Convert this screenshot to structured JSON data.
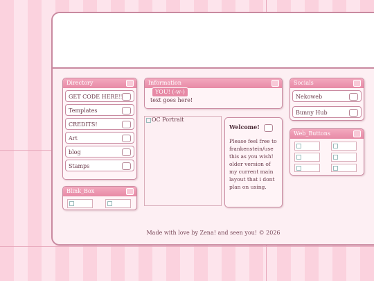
{
  "directory": {
    "title": "Directory",
    "items": [
      "GET CODE HERE!!!!!",
      "Templates",
      "CREDITS!",
      "Art",
      "blog",
      "Stamps"
    ]
  },
  "blinkies": {
    "title": "Blink_Box"
  },
  "information": {
    "title": "Information",
    "badge": "YOU! (-w-)",
    "text": "text goes here!"
  },
  "oc": {
    "alt_text": "OC Portrait"
  },
  "welcome": {
    "title": "Welcome!",
    "body": "Please feel free to frankenstein/use this as you wish! older version of my current main layout that i dont plan on using."
  },
  "socials": {
    "title": "Socials",
    "items": [
      "Nekoweb",
      "Bunny Hub"
    ]
  },
  "buttons": {
    "title": "Web_Buttons"
  },
  "footer": {
    "text": "Made with love by Zena! and seen you! © 2026"
  }
}
